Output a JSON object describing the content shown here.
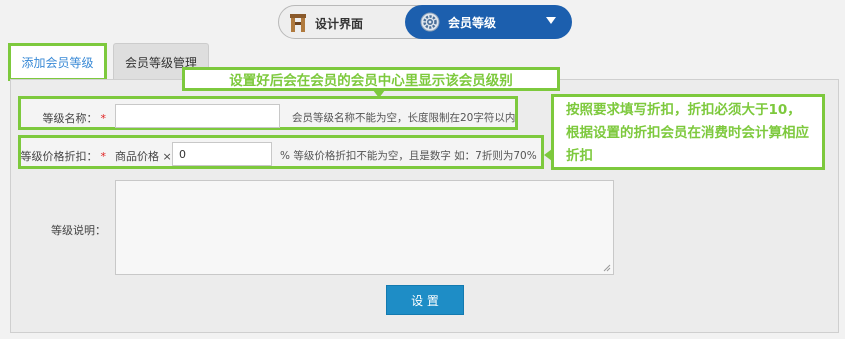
{
  "nav": {
    "design_label": "设计界面",
    "member_label": "会员等级",
    "active": "member"
  },
  "tabs": {
    "add_label": "添加会员等级",
    "manage_label": "会员等级管理",
    "active": "add"
  },
  "form": {
    "name": {
      "label": "等级名称：",
      "required_mark": "*",
      "value": "",
      "hint": "会员等级名称不能为空，长度限制在20字符以内"
    },
    "discount": {
      "label": "等级价格折扣：",
      "required_mark": "*",
      "prefix": "商品价格 ×",
      "value": "0",
      "hint": "% 等级价格折扣不能为空，且是数字 如：7折则为70%"
    },
    "description": {
      "label": "等级说明：",
      "value": ""
    },
    "submit_label": "设 置"
  },
  "callouts": {
    "top": "设置好后会在会员的会员中心里显示该会员级别",
    "right": "按照要求填写折扣，折扣必须大于10，根据设置的折扣会员在消费时会计算相应折扣"
  },
  "colors": {
    "accent_green": "#7dc93d",
    "nav_blue": "#1c5fae",
    "button_blue": "#1e8dc6",
    "required_red": "#e02020"
  }
}
